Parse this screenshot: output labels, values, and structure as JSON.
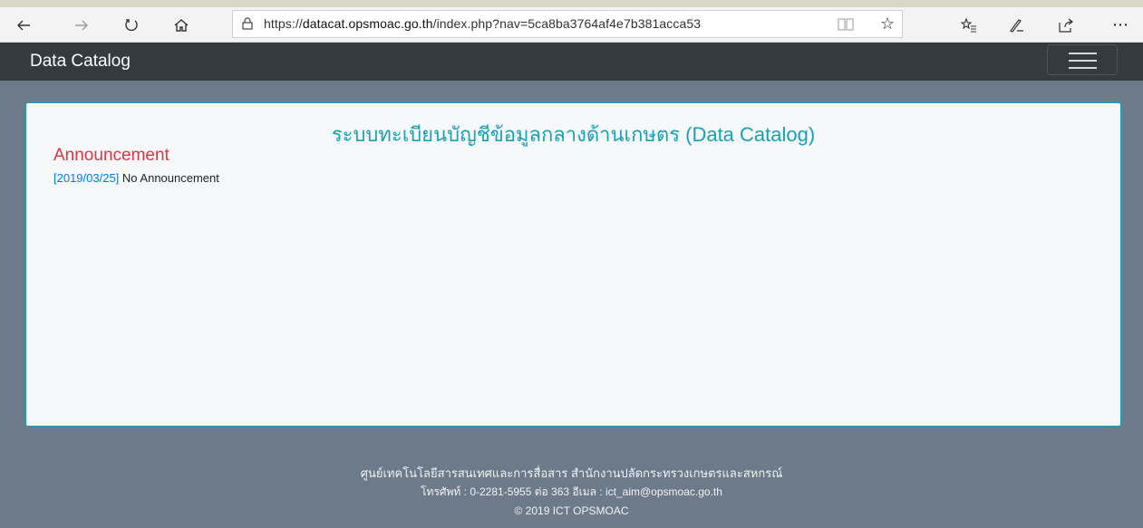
{
  "browser": {
    "url_prefix": "https://",
    "url_domain": "datacat.opsmoac.go.th",
    "url_path": "/index.php?nav=5ca8ba3764af4e7b381acca53"
  },
  "navbar": {
    "brand": "Data Catalog"
  },
  "card": {
    "title": "ระบบทะเบียนบัญชีข้อมูลกลางด้านเกษตร (Data Catalog)",
    "announcement_heading": "Announcement",
    "announcements": [
      {
        "date": "[2019/03/25]",
        "text": " No Announcement"
      }
    ]
  },
  "footer": {
    "line1": "ศูนย์เทคโนโลยีสารสนเทศและการสื่อสาร สำนักงานปลัดกระทรวงเกษตรและสหกรณ์",
    "line2": "โทรศัพท์ : 0-2281-5955 ต่อ 363 อีเมล : ict_aim@opsmoac.go.th",
    "line3": "© 2019 ICT OPSMOAC"
  },
  "colors": {
    "accent": "#17a2b8",
    "announcement": "#dc3545",
    "link": "#007bff",
    "navbar": "#343a40",
    "page_bg": "#6c7a89"
  }
}
